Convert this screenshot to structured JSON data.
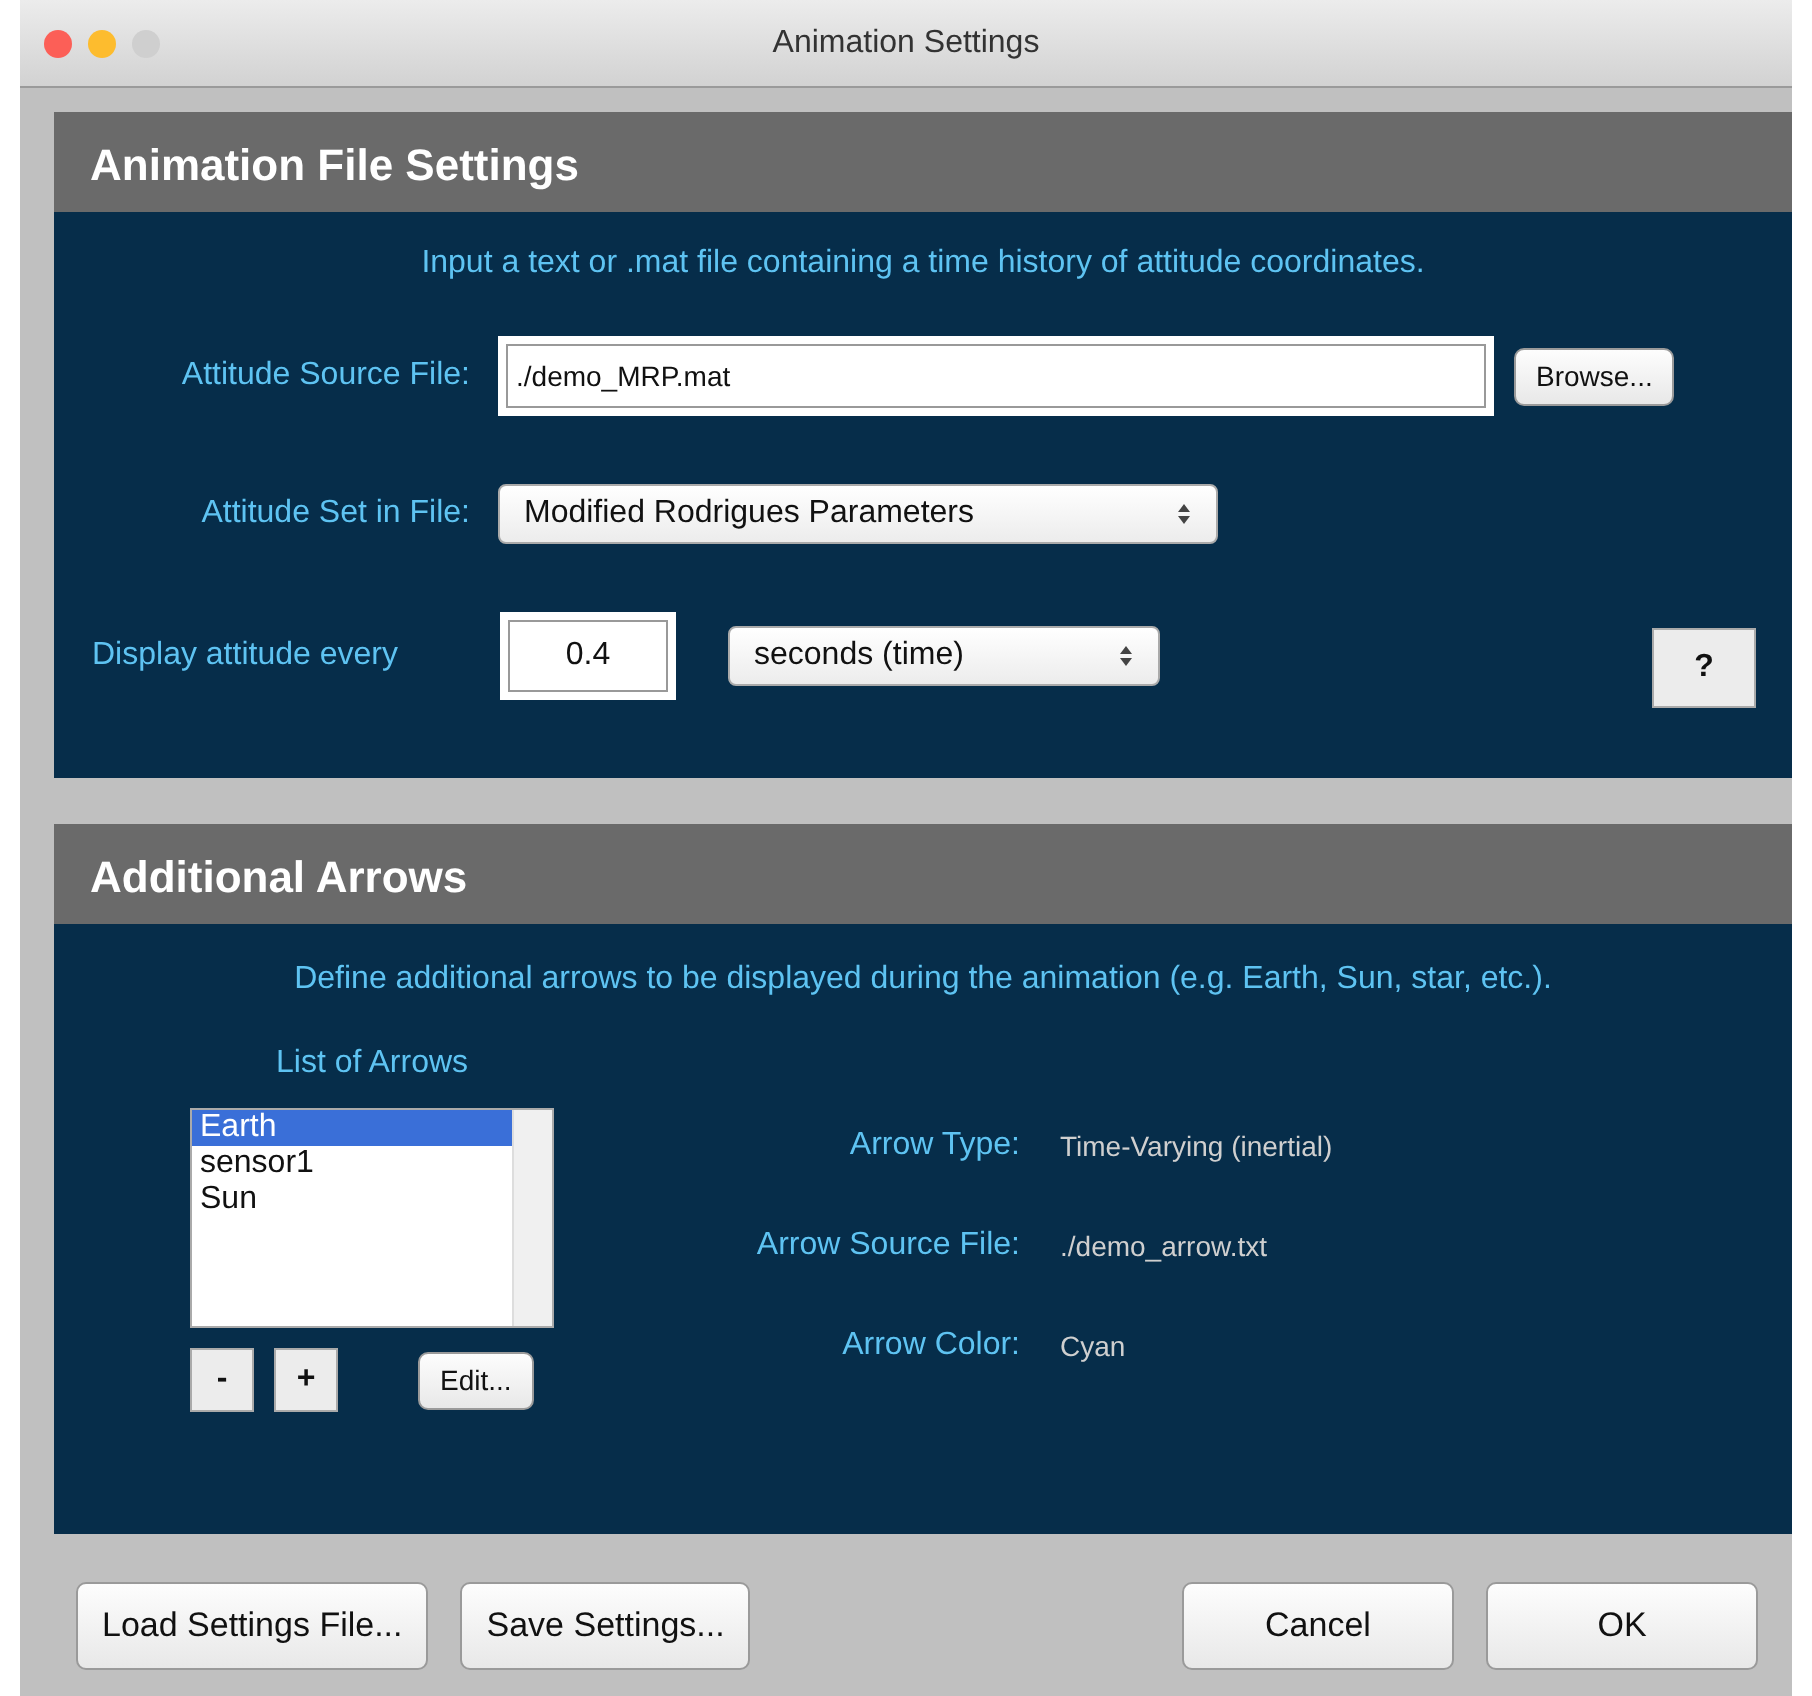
{
  "window": {
    "title": "Animation Settings"
  },
  "file_panel": {
    "title": "Animation File Settings",
    "description": "Input a text or .mat file containing a time history of attitude coordinates.",
    "source_label": "Attitude Source File:",
    "source_value": "./demo_MRP.mat",
    "browse": "Browse...",
    "set_label": "Attitude Set in File:",
    "set_value": "Modified Rodrigues Parameters",
    "every_label": "Display attitude every",
    "every_value": "0.4",
    "unit_value": "seconds (time)",
    "help": "?"
  },
  "arrows_panel": {
    "title": "Additional Arrows",
    "description": "Define additional arrows to be displayed during the animation (e.g. Earth, Sun, star, etc.).",
    "list_label": "List of Arrows",
    "arrows": [
      {
        "label": "Earth",
        "selected": true
      },
      {
        "label": "sensor1",
        "selected": false
      },
      {
        "label": "Sun",
        "selected": false
      }
    ],
    "remove": "-",
    "add": "+",
    "edit": "Edit...",
    "details": [
      {
        "label": "Arrow Type:",
        "value": "Time-Varying (inertial)"
      },
      {
        "label": "Arrow Source File:",
        "value": "./demo_arrow.txt"
      },
      {
        "label": "Arrow Color:",
        "value": "Cyan"
      }
    ]
  },
  "buttons": {
    "left": [
      "Load Settings File...",
      "Save Settings..."
    ],
    "right": [
      "Cancel",
      "OK"
    ]
  }
}
